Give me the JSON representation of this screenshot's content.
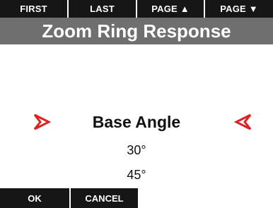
{
  "topbar": {
    "first_label": "FIRST",
    "last_label": "LAST",
    "page_up_label": "PAGE ▲",
    "page_down_label": "PAGE ▼"
  },
  "title": "Zoom Ring Response",
  "selector": {
    "label": "Base Angle",
    "options": [
      "30°",
      "45°"
    ],
    "arrow_color": "#e02020",
    "left_arrow_icon": "arrow-right-outline-icon",
    "right_arrow_icon": "arrow-left-outline-icon"
  },
  "bottombar": {
    "ok_label": "OK",
    "cancel_label": "CANCEL"
  }
}
